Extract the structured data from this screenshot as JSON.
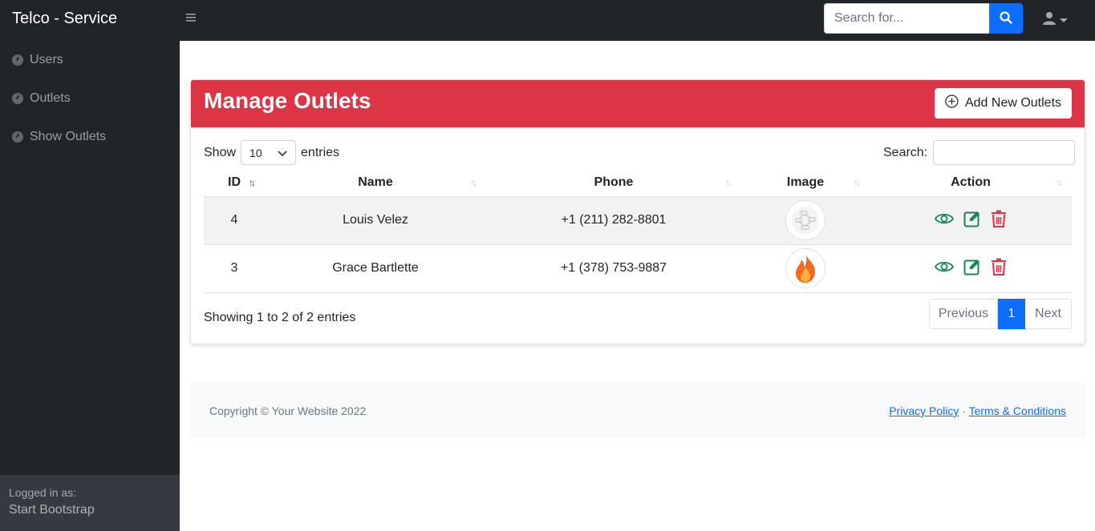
{
  "app": {
    "brand": "Telco - Service"
  },
  "topbar": {
    "search_placeholder": "Search for...",
    "search_icon": "search-icon",
    "user_icon": "user-icon"
  },
  "sidebar": {
    "items": [
      {
        "label": "Users",
        "icon": "gauge-icon"
      },
      {
        "label": "Outlets",
        "icon": "gauge-icon"
      },
      {
        "label": "Show Outlets",
        "icon": "gauge-icon"
      }
    ],
    "footer": {
      "caption": "Logged in as:",
      "user": "Start Bootstrap"
    }
  },
  "card": {
    "title": "Manage Outlets",
    "add_button": "Add New Outlets",
    "header_color": "#dc3545"
  },
  "table_controls": {
    "show_label": "Show",
    "page_length": "10",
    "entries_label": "entries",
    "search_label": "Search:"
  },
  "table": {
    "columns": [
      "ID",
      "Name",
      "Phone",
      "Image",
      "Action"
    ],
    "rows": [
      {
        "id": "4",
        "name": "Louis Velez",
        "phone": "+1 (211) 282-8801",
        "image": "diagram-thumbnail"
      },
      {
        "id": "3",
        "name": "Grace Bartlette",
        "phone": "+1 (378) 753-9887",
        "image": "fire-thumbnail"
      }
    ]
  },
  "pagination": {
    "info": "Showing 1 to 2 of 2 entries",
    "previous": "Previous",
    "current": "1",
    "next": "Next"
  },
  "footer": {
    "copyright": "Copyright © Your Website 2022",
    "privacy": "Privacy Policy",
    "separator": "·",
    "terms": "Terms & Conditions"
  },
  "colors": {
    "primary": "#0d6efd",
    "danger": "#dc3545",
    "success": "#198754",
    "dark": "#212529"
  }
}
